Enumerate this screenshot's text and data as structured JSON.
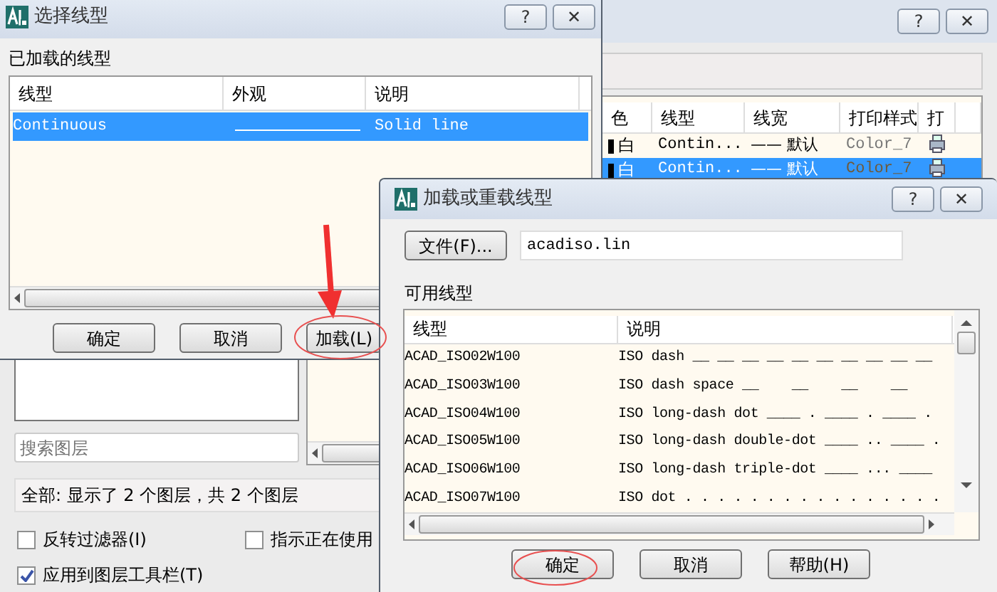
{
  "layer_window": {
    "help": "?",
    "close": "✕",
    "columns": [
      "色",
      "线型",
      "线宽",
      "打印样式",
      "打"
    ],
    "rows": [
      {
        "cells": [
          "白",
          "Contin...",
          "—— 默认",
          "Color_7"
        ],
        "selected": false
      },
      {
        "cells": [
          "白",
          "Contin...",
          "—— 默认",
          "Color_7"
        ],
        "selected": true
      }
    ],
    "search": {
      "placeholder": "搜索图层"
    },
    "status": "全部: 显示了 2 个图层，共 2 个图层",
    "checkboxes": [
      {
        "label": "反转过滤器(I)",
        "checked": false
      },
      {
        "label": "指示正在使用",
        "checked": false
      },
      {
        "label": "应用到图层工具栏(T)",
        "checked": true
      }
    ]
  },
  "select_dialog": {
    "title": "选择线型",
    "help": "?",
    "close": "✕",
    "section_label": "已加载的线型",
    "columns": [
      "线型",
      "外观",
      "说明"
    ],
    "rows": [
      {
        "linetype": "Continuous",
        "description": "Solid line",
        "selected": true
      }
    ],
    "buttons": [
      "确定",
      "取消",
      "加载(L)"
    ]
  },
  "load_dialog": {
    "title": "加载或重载线型",
    "help": "?",
    "close": "✕",
    "file_button": "文件(F)...",
    "file_value": "acadiso.lin",
    "section_label": "可用线型",
    "columns": [
      "线型",
      "说明"
    ],
    "rows": [
      {
        "linetype": "ACAD_ISO02W100",
        "description": "ISO dash __ __ __ __ __ __ __ __ __ __"
      },
      {
        "linetype": "ACAD_ISO03W100",
        "description": "ISO dash space __    __    __    __"
      },
      {
        "linetype": "ACAD_ISO04W100",
        "description": "ISO long-dash dot ____ . ____ . ____ ."
      },
      {
        "linetype": "ACAD_ISO05W100",
        "description": "ISO long-dash double-dot ____ .. ____ ."
      },
      {
        "linetype": "ACAD_ISO06W100",
        "description": "ISO long-dash triple-dot ____ ... ____"
      },
      {
        "linetype": "ACAD_ISO07W100",
        "description": "ISO dot . . . . . . . . . . . . . . . ."
      }
    ],
    "buttons": [
      "确定",
      "取消",
      "帮助(H)"
    ]
  }
}
